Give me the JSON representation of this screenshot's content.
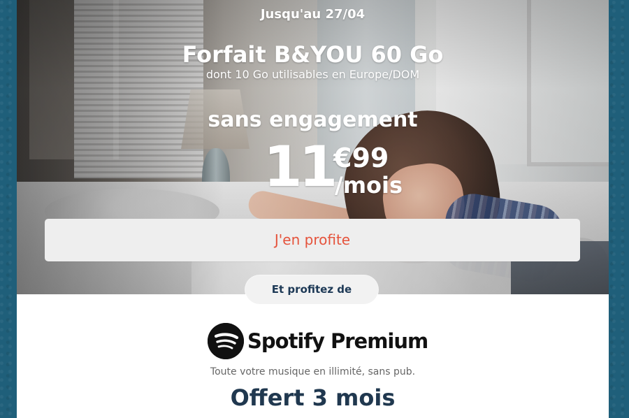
{
  "promo": {
    "date": "Jusqu'au 27/04",
    "title": "Forfait B&YOU 60 Go",
    "subtitle": "dont 10 Go utilisables en Europe/DOM",
    "engagement": "sans engagement",
    "price_main": "11",
    "price_cents": "€99",
    "price_period": "/mois",
    "cta": "J'en profite"
  },
  "bonus": {
    "label": "Et profitez de",
    "brand": "Spotify Premium",
    "description": "Toute votre musique en illimité, sans pub.",
    "offer": "Offert 3 mois"
  },
  "colors": {
    "background": "#1f5f7a",
    "cta_text": "#e5533c",
    "headline_dark": "#20384f",
    "spotify_black": "#111111"
  },
  "icons": {
    "spotify": "spotify-logo-icon"
  }
}
